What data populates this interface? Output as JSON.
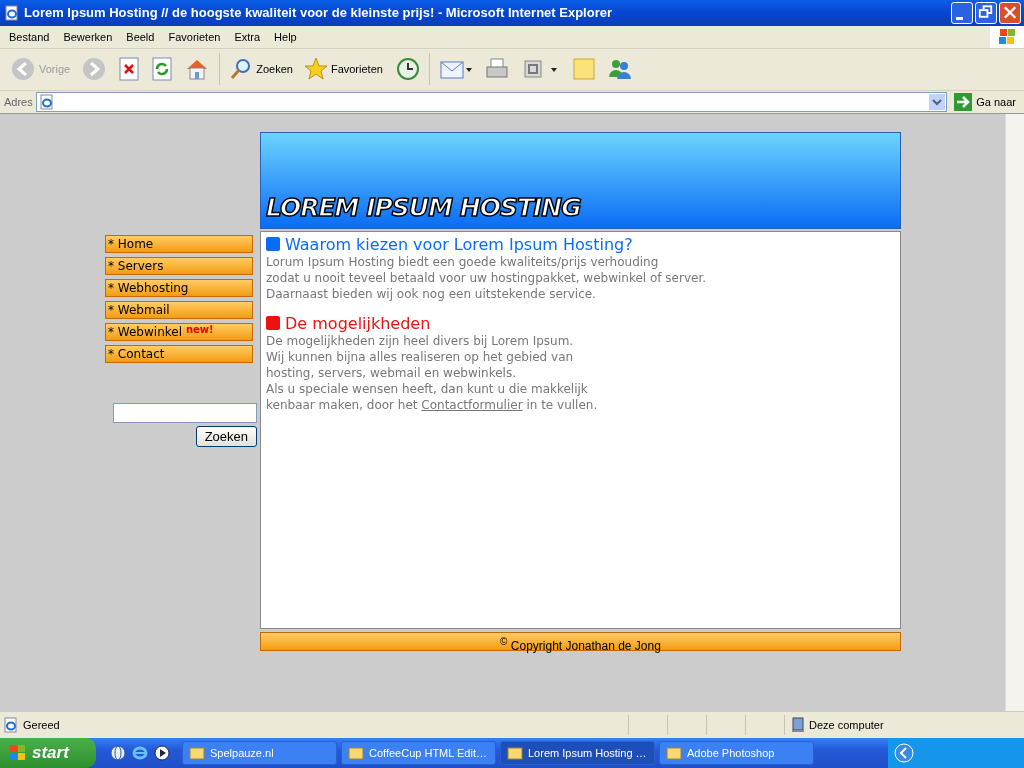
{
  "window": {
    "title": "Lorem Ipsum Hosting // de hoogste kwaliteit voor de kleinste prijs! - Microsoft Internet Explorer"
  },
  "menu": [
    "Bestand",
    "Bewerken",
    "Beeld",
    "Favorieten",
    "Extra",
    "Help"
  ],
  "toolbar": [
    {
      "kind": "back",
      "label": "Vorige",
      "disabled": true
    },
    {
      "kind": "forward",
      "disabled": true
    },
    {
      "kind": "stop"
    },
    {
      "kind": "refresh"
    },
    {
      "kind": "home"
    },
    {
      "kind": "search",
      "label": "Zoeken"
    },
    {
      "kind": "favorites",
      "label": "Favorieten"
    },
    {
      "kind": "history"
    },
    {
      "kind": "mail"
    },
    {
      "kind": "print"
    },
    {
      "kind": "edit"
    },
    {
      "kind": "note"
    },
    {
      "kind": "messenger"
    }
  ],
  "address": {
    "label": "Adres",
    "go": "Ga naar"
  },
  "page": {
    "banner": "LOREM IPSUM HOSTING",
    "nav": [
      {
        "label": "* Home"
      },
      {
        "label": "* Servers"
      },
      {
        "label": "* Webhosting"
      },
      {
        "label": "* Webmail"
      },
      {
        "label": "* Webwinkel",
        "badge": "new!"
      },
      {
        "label": "* Contact"
      }
    ],
    "search": {
      "button": "Zoeken"
    },
    "sections": [
      {
        "title": "Waarom kiezen voor Lorem Ipsum Hosting?",
        "color": "#0a6cf5",
        "lines": [
          "Lorum Ipsum Hosting biedt een goede kwaliteits/prijs verhouding",
          "zodat u nooit teveel betaald voor uw hostingpakket, webwinkel of server.",
          "Daarnaast bieden wij ook nog een uitstekende service."
        ]
      },
      {
        "title": "De mogelijkheden",
        "color": "#ee1111",
        "lines": [
          "De mogelijkheden zijn heel divers bij Lorem Ipsum.",
          "Wij kunnen bijna alles realiseren op het gebied van",
          "hosting, servers, webmail en webwinkels.",
          "Als u speciale wensen heeft, dan kunt u die makkelijk"
        ],
        "link": {
          "before": "kenbaar maken, door het ",
          "text": "Contactformulier",
          "after": " in te vullen."
        }
      }
    ],
    "footer": "$^{©}$ Copyright Jonathan de Jong"
  },
  "status_bar": {
    "text": "Gereed",
    "zone": "Deze computer"
  },
  "taskbar": {
    "start": "start",
    "items": [
      {
        "label": "Spelpauze.nl",
        "selected": false
      },
      {
        "label": "CoffeeCup HTML Edit…",
        "selected": false
      },
      {
        "label": "Lorem Ipsum Hosting …",
        "selected": true
      },
      {
        "label": "Adobe Photoshop",
        "selected": false
      }
    ]
  }
}
